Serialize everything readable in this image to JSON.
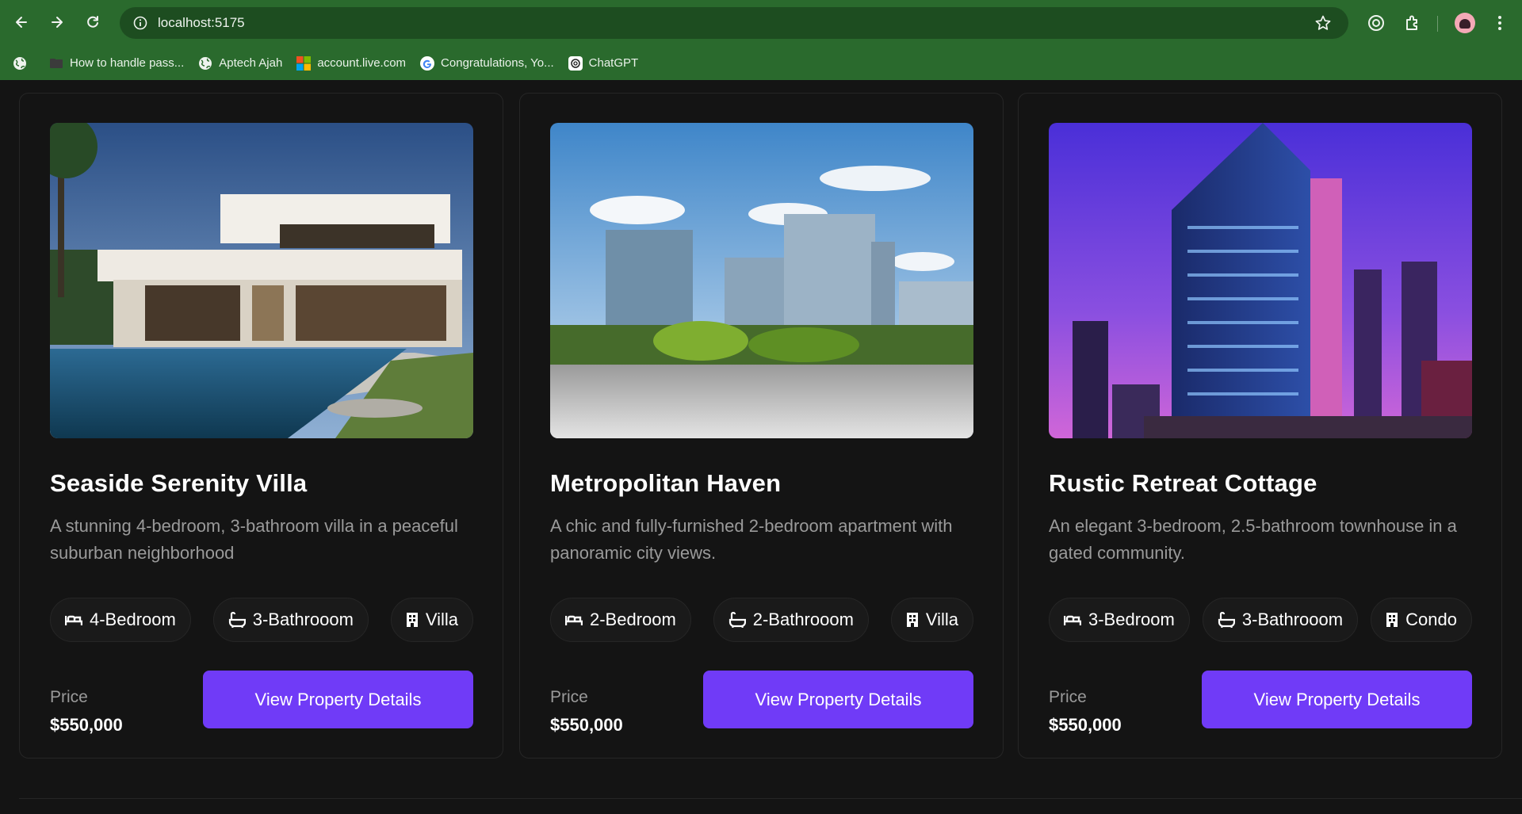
{
  "browser": {
    "url": "localhost:5175",
    "bookmarks": [
      {
        "label": "How to handle pass...",
        "icon": "folder-icon"
      },
      {
        "label": "Aptech Ajah",
        "icon": "globe-icon"
      },
      {
        "label": "account.live.com",
        "icon": "microsoft-icon"
      },
      {
        "label": "Congratulations, Yo...",
        "icon": "google-icon"
      },
      {
        "label": "ChatGPT",
        "icon": "chatgpt-icon"
      }
    ],
    "theme_color": "#2a6a2d"
  },
  "accent_color": "#703bf7",
  "properties": [
    {
      "title": "Seaside Serenity Villa",
      "description": "A stunning 4-bedroom, 3-bathroom villa in a peaceful suburban neighborhood",
      "tags": [
        "4-Bedroom",
        "3-Bathrooom",
        "Villa"
      ],
      "price_label": "Price",
      "price": "$550,000",
      "button": "View Property Details",
      "image": "modern-white-villa-with-pool"
    },
    {
      "title": "Metropolitan Haven",
      "description": "A chic and fully-furnished 2-bedroom apartment with panoramic city views.",
      "tags": [
        "2-Bedroom",
        "2-Bathrooom",
        "Villa"
      ],
      "price_label": "Price",
      "price": "$550,000",
      "button": "View Property Details",
      "image": "city-office-buildings-daytime"
    },
    {
      "title": "Rustic Retreat Cottage",
      "description": "An elegant 3-bedroom, 2.5-bathroom townhouse in a gated community.",
      "tags": [
        "3-Bedroom",
        "3-Bathrooom",
        "Condo"
      ],
      "price_label": "Price",
      "price": "$550,000",
      "button": "View Property Details",
      "image": "skyscraper-at-dusk-purple-sky"
    }
  ]
}
